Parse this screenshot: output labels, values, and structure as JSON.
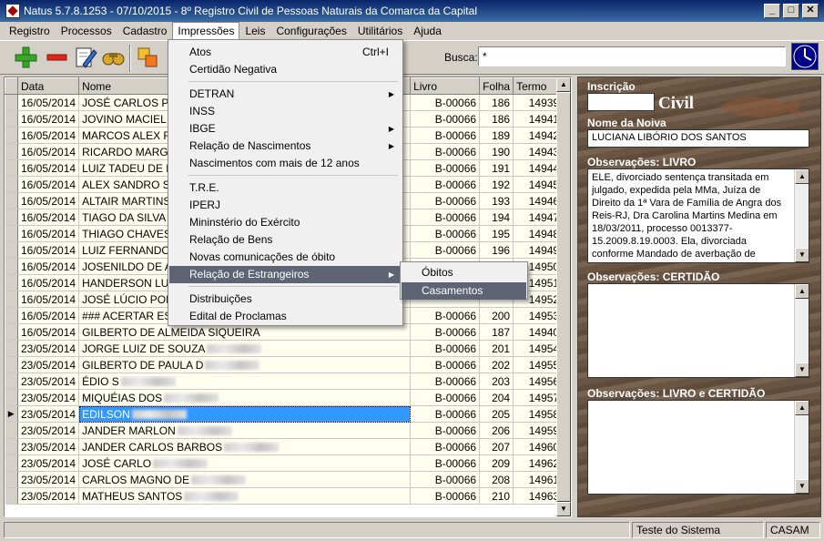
{
  "window": {
    "title": "Natus 5.7.8.1253 - 07/10/2015 - 8º Registro Civil de Pessoas Naturais da Comarca da Capital",
    "minimize": "_",
    "maximize": "□",
    "close": "✕"
  },
  "menubar": [
    "Registro",
    "Processos",
    "Cadastro",
    "Impressões",
    "Leis",
    "Configurações",
    "Utilitários",
    "Ajuda"
  ],
  "toolbar": {
    "icons": [
      "add-icon",
      "remove-icon",
      "edit-icon",
      "find-icon",
      "export-icon"
    ]
  },
  "search": {
    "label": "Busca:",
    "value": "*"
  },
  "grid": {
    "columns": [
      "Data",
      "Nome",
      "Livro",
      "Folha",
      "Termo"
    ],
    "rows": [
      {
        "data": "16/05/2014",
        "nome": "JOSÉ CARLOS PEF",
        "livro": "B-00066",
        "folha": "186",
        "termo": "14939",
        "blur": false
      },
      {
        "data": "16/05/2014",
        "nome": "JOVINO MACIEL DE",
        "livro": "B-00066",
        "folha": "186",
        "termo": "14941",
        "blur": false
      },
      {
        "data": "16/05/2014",
        "nome": "MARCOS ALEX FOC",
        "livro": "B-00066",
        "folha": "189",
        "termo": "14942",
        "blur": false
      },
      {
        "data": "16/05/2014",
        "nome": "RICARDO MARGAL",
        "livro": "B-00066",
        "folha": "190",
        "termo": "14943",
        "blur": false
      },
      {
        "data": "16/05/2014",
        "nome": "LUIZ TADEU DE MA",
        "livro": "B-00066",
        "folha": "191",
        "termo": "14944",
        "blur": false
      },
      {
        "data": "16/05/2014",
        "nome": "ALEX SANDRO SOU",
        "livro": "B-00066",
        "folha": "192",
        "termo": "14945",
        "blur": false
      },
      {
        "data": "16/05/2014",
        "nome": "ALTAIR MARTINS N",
        "livro": "B-00066",
        "folha": "193",
        "termo": "14946",
        "blur": false
      },
      {
        "data": "16/05/2014",
        "nome": "TIAGO DA SILVA G",
        "livro": "B-00066",
        "folha": "194",
        "termo": "14947",
        "blur": false
      },
      {
        "data": "16/05/2014",
        "nome": "THIAGO CHAVES M",
        "livro": "B-00066",
        "folha": "195",
        "termo": "14948",
        "blur": false
      },
      {
        "data": "16/05/2014",
        "nome": "LUIZ FERNANDO M",
        "livro": "B-00066",
        "folha": "196",
        "termo": "14949",
        "blur": false
      },
      {
        "data": "16/05/2014",
        "nome": "JOSENILDO DE AS",
        "livro": "",
        "folha": "",
        "termo": "14950",
        "blur": false
      },
      {
        "data": "16/05/2014",
        "nome": "HANDERSON LUIZ",
        "livro": "",
        "folha": "",
        "termo": "14951",
        "blur": false
      },
      {
        "data": "16/05/2014",
        "nome": "JOSÉ LÚCIO PORFI",
        "livro": "",
        "folha": "",
        "termo": "14952",
        "blur": false
      },
      {
        "data": "16/05/2014",
        "nome": "### ACERTAR ES",
        "livro": "B-00066",
        "folha": "200",
        "termo": "14953",
        "blur": false
      },
      {
        "data": "16/05/2014",
        "nome": "GILBERTO DE ALMEIDA SIQUEIRA",
        "livro": "B-00066",
        "folha": "187",
        "termo": "14940",
        "blur": false
      },
      {
        "data": "23/05/2014",
        "nome": "JORGE LUIZ DE SOUZA",
        "livro": "B-00066",
        "folha": "201",
        "termo": "14954",
        "blur": true
      },
      {
        "data": "23/05/2014",
        "nome": "GILBERTO DE PAULA D",
        "livro": "B-00066",
        "folha": "202",
        "termo": "14955",
        "blur": true
      },
      {
        "data": "23/05/2014",
        "nome": "ÉDIO S",
        "livro": "B-00066",
        "folha": "203",
        "termo": "14956",
        "blur": true
      },
      {
        "data": "23/05/2014",
        "nome": "MIQUÉIAS DOS",
        "livro": "B-00066",
        "folha": "204",
        "termo": "14957",
        "blur": true
      },
      {
        "data": "23/05/2014",
        "nome": "EDILSON",
        "livro": "B-00066",
        "folha": "205",
        "termo": "14958",
        "blur": true,
        "selected": true
      },
      {
        "data": "23/05/2014",
        "nome": "JANDER MARLON",
        "livro": "B-00066",
        "folha": "206",
        "termo": "14959",
        "blur": true
      },
      {
        "data": "23/05/2014",
        "nome": "JANDER CARLOS BARBOS",
        "livro": "B-00066",
        "folha": "207",
        "termo": "14960",
        "blur": true
      },
      {
        "data": "23/05/2014",
        "nome": "JOSÉ CARLO",
        "livro": "B-00066",
        "folha": "209",
        "termo": "14962",
        "blur": true
      },
      {
        "data": "23/05/2014",
        "nome": "CARLOS MAGNO DE",
        "livro": "B-00066",
        "folha": "208",
        "termo": "14961",
        "blur": true
      },
      {
        "data": "23/05/2014",
        "nome": "MATHEUS SANTOS",
        "livro": "B-00066",
        "folha": "210",
        "termo": "14963",
        "blur": true
      }
    ]
  },
  "panel": {
    "inscricao_label": "Inscrição",
    "civil_text": "Civil",
    "noiva_label": "Nome da Noiva",
    "noiva_value": "LUCIANA LIBÓRIO DOS SANTOS",
    "obs_livro_label": "Observações: LIVRO",
    "obs_livro_text": "ELE, divorciado sentença transitada em julgado, expedida pela MMa, Juíza de Direito da 1ª Vara de Família de Angra dos Reis-RJ, Dra Carolina Martins Medina em 18/03/2011, processo 0013377-15.2009.8.19.0003. Ela, divorciada conforme Mandado de averbação de Divórcio, datado de",
    "obs_certidao_label": "Observações: CERTIDÃO",
    "obs_ambos_label": "Observações: LIVRO e CERTIDÃO"
  },
  "status": {
    "left": "",
    "middle": "Teste do Sistema",
    "right": "CASAM"
  },
  "dropdown": {
    "items": [
      {
        "label": "Atos",
        "shortcut": "Ctrl+I"
      },
      {
        "label": "Certidão Negativa"
      },
      {
        "label": "DETRAN",
        "submenu": true
      },
      {
        "label": "INSS"
      },
      {
        "label": "IBGE",
        "submenu": true
      },
      {
        "label": "Relação de Nascimentos",
        "submenu": true
      },
      {
        "label": "Nascimentos com mais de 12 anos"
      },
      {
        "label": "T.R.E."
      },
      {
        "label": "IPERJ"
      },
      {
        "label": "Mininstério do Exército"
      },
      {
        "label": "Relação de Bens"
      },
      {
        "label": "Novas comunicações de óbito"
      },
      {
        "label": "Relação de Estrangeiros",
        "submenu": true,
        "highlighted": true
      },
      {
        "label": "Distribuições"
      },
      {
        "label": "Edital de Proclamas"
      }
    ],
    "submenu_items": [
      {
        "label": "Óbitos"
      },
      {
        "label": "Casamentos",
        "highlighted": true
      }
    ]
  }
}
